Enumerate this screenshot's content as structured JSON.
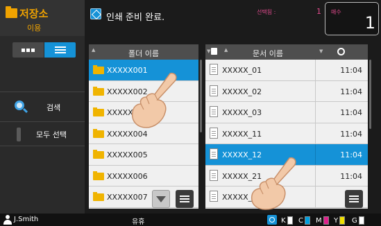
{
  "sidebar": {
    "title": "저장소",
    "subtitle": "이용",
    "search_label": "검색",
    "select_all_label": "모두 선택"
  },
  "topbar": {
    "status": "인쇄 준비 완료.",
    "selected_label": "선택됨 :",
    "selected_count": "1",
    "copies_label": "매수",
    "copies_value": "1"
  },
  "folders": {
    "header": "폴더 이름",
    "items": [
      {
        "name": "XXXXX001",
        "selected": true
      },
      {
        "name": "XXXXX002",
        "selected": false
      },
      {
        "name": "XXXXX003",
        "selected": false
      },
      {
        "name": "XXXXX004",
        "selected": false
      },
      {
        "name": "XXXXX005",
        "selected": false
      },
      {
        "name": "XXXXX006",
        "selected": false
      },
      {
        "name": "XXXXX007",
        "selected": false
      }
    ]
  },
  "documents": {
    "header": "문서 이름",
    "items": [
      {
        "name": "XXXXX_01",
        "time": "11:04",
        "selected": false
      },
      {
        "name": "XXXXX_02",
        "time": "11:04",
        "selected": false
      },
      {
        "name": "XXXXX_03",
        "time": "11:04",
        "selected": false
      },
      {
        "name": "XXXXX_11",
        "time": "11:04",
        "selected": false
      },
      {
        "name": "XXXXX_12",
        "time": "11:04",
        "selected": true
      },
      {
        "name": "XXXXX_21",
        "time": "11:04",
        "selected": false
      },
      {
        "name": "XXXXX_22",
        "time": "",
        "selected": false
      }
    ]
  },
  "bottombar": {
    "user": "J.Smith",
    "status": "유휴",
    "toner": [
      {
        "label": "K",
        "color": "#ffffff"
      },
      {
        "label": "C",
        "color": "#00a0e0"
      },
      {
        "label": "M",
        "color": "#e0208c"
      },
      {
        "label": "Y",
        "color": "#f0e000"
      },
      {
        "label": "G",
        "color": "#ffffff"
      }
    ]
  },
  "colors": {
    "accent": "#1592d7",
    "brand": "#f0a300",
    "pink": "#e04a8c"
  }
}
